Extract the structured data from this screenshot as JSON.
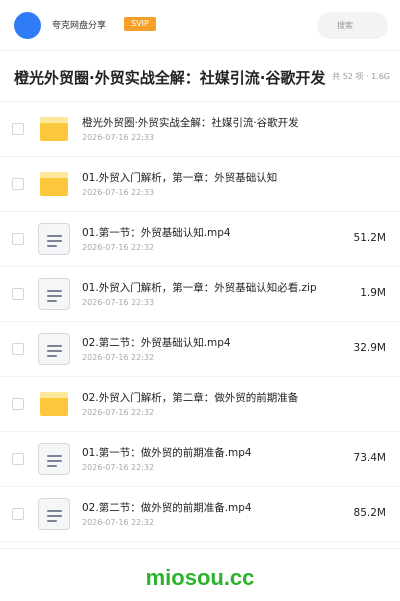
{
  "header": {
    "brand": "夸克网盘分享",
    "badge": "SVIP",
    "search_placeholder": "搜索"
  },
  "title_bar": {
    "title": "橙光外贸圈·外贸实战全解：社媒引流·谷歌开发",
    "meta": "共 52 项 · 1.6G"
  },
  "files": [
    {
      "type": "folder",
      "name": "橙光外贸圈·外贸实战全解：社媒引流·谷歌开发",
      "date": "2026-07-16 22:33",
      "size": ""
    },
    {
      "type": "folder",
      "name": "01.外贸入门解析，第一章：外贸基础认知",
      "date": "2026-07-16 22:33",
      "size": ""
    },
    {
      "type": "file",
      "name": "01.第一节：外贸基础认知.mp4",
      "date": "2026-07-16 22:32",
      "size": "51.2M"
    },
    {
      "type": "file",
      "name": "01.外贸入门解析，第一章：外贸基础认知必看.zip",
      "date": "2026-07-16 22:33",
      "size": "1.9M"
    },
    {
      "type": "file",
      "name": "02.第二节：外贸基础认知.mp4",
      "date": "2026-07-16 22:32",
      "size": "32.9M"
    },
    {
      "type": "folder",
      "name": "02.外贸入门解析，第二章：做外贸的前期准备",
      "date": "2026-07-16 22:32",
      "size": ""
    },
    {
      "type": "file",
      "name": "01.第一节：做外贸的前期准备.mp4",
      "date": "2026-07-16 22:32",
      "size": "73.4M"
    },
    {
      "type": "file",
      "name": "02.第二节：做外贸的前期准备.mp4",
      "date": "2026-07-16 22:32",
      "size": "85.2M"
    }
  ],
  "footer": {
    "watermark": "miosou.cc"
  },
  "colors": {
    "accent": "#2f7cf6",
    "badge": "#f6a02a",
    "folder": "#fbc73b",
    "watermark": "#2bb32b"
  }
}
